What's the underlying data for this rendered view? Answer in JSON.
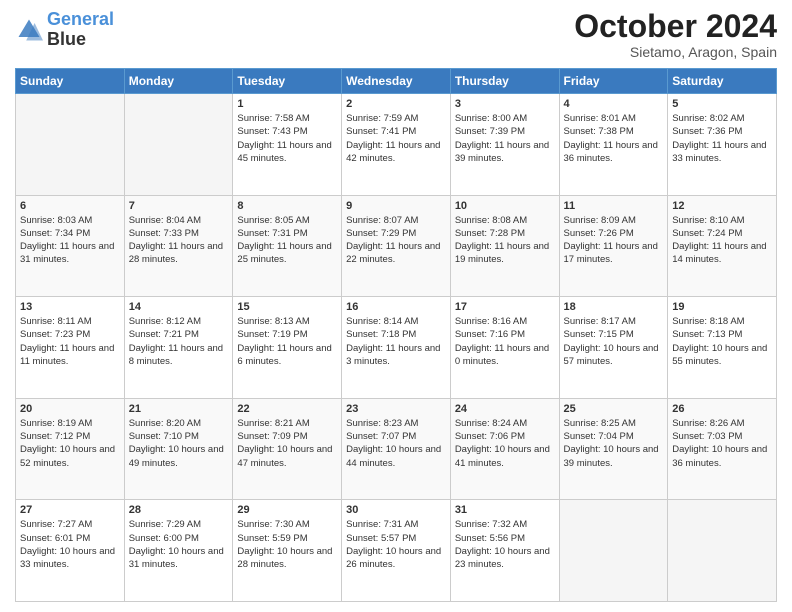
{
  "header": {
    "logo_line1": "General",
    "logo_line2": "Blue",
    "month": "October 2024",
    "location": "Sietamo, Aragon, Spain"
  },
  "weekdays": [
    "Sunday",
    "Monday",
    "Tuesday",
    "Wednesday",
    "Thursday",
    "Friday",
    "Saturday"
  ],
  "weeks": [
    [
      {
        "day": "",
        "info": ""
      },
      {
        "day": "",
        "info": ""
      },
      {
        "day": "1",
        "info": "Sunrise: 7:58 AM\nSunset: 7:43 PM\nDaylight: 11 hours and 45 minutes."
      },
      {
        "day": "2",
        "info": "Sunrise: 7:59 AM\nSunset: 7:41 PM\nDaylight: 11 hours and 42 minutes."
      },
      {
        "day": "3",
        "info": "Sunrise: 8:00 AM\nSunset: 7:39 PM\nDaylight: 11 hours and 39 minutes."
      },
      {
        "day": "4",
        "info": "Sunrise: 8:01 AM\nSunset: 7:38 PM\nDaylight: 11 hours and 36 minutes."
      },
      {
        "day": "5",
        "info": "Sunrise: 8:02 AM\nSunset: 7:36 PM\nDaylight: 11 hours and 33 minutes."
      }
    ],
    [
      {
        "day": "6",
        "info": "Sunrise: 8:03 AM\nSunset: 7:34 PM\nDaylight: 11 hours and 31 minutes."
      },
      {
        "day": "7",
        "info": "Sunrise: 8:04 AM\nSunset: 7:33 PM\nDaylight: 11 hours and 28 minutes."
      },
      {
        "day": "8",
        "info": "Sunrise: 8:05 AM\nSunset: 7:31 PM\nDaylight: 11 hours and 25 minutes."
      },
      {
        "day": "9",
        "info": "Sunrise: 8:07 AM\nSunset: 7:29 PM\nDaylight: 11 hours and 22 minutes."
      },
      {
        "day": "10",
        "info": "Sunrise: 8:08 AM\nSunset: 7:28 PM\nDaylight: 11 hours and 19 minutes."
      },
      {
        "day": "11",
        "info": "Sunrise: 8:09 AM\nSunset: 7:26 PM\nDaylight: 11 hours and 17 minutes."
      },
      {
        "day": "12",
        "info": "Sunrise: 8:10 AM\nSunset: 7:24 PM\nDaylight: 11 hours and 14 minutes."
      }
    ],
    [
      {
        "day": "13",
        "info": "Sunrise: 8:11 AM\nSunset: 7:23 PM\nDaylight: 11 hours and 11 minutes."
      },
      {
        "day": "14",
        "info": "Sunrise: 8:12 AM\nSunset: 7:21 PM\nDaylight: 11 hours and 8 minutes."
      },
      {
        "day": "15",
        "info": "Sunrise: 8:13 AM\nSunset: 7:19 PM\nDaylight: 11 hours and 6 minutes."
      },
      {
        "day": "16",
        "info": "Sunrise: 8:14 AM\nSunset: 7:18 PM\nDaylight: 11 hours and 3 minutes."
      },
      {
        "day": "17",
        "info": "Sunrise: 8:16 AM\nSunset: 7:16 PM\nDaylight: 11 hours and 0 minutes."
      },
      {
        "day": "18",
        "info": "Sunrise: 8:17 AM\nSunset: 7:15 PM\nDaylight: 10 hours and 57 minutes."
      },
      {
        "day": "19",
        "info": "Sunrise: 8:18 AM\nSunset: 7:13 PM\nDaylight: 10 hours and 55 minutes."
      }
    ],
    [
      {
        "day": "20",
        "info": "Sunrise: 8:19 AM\nSunset: 7:12 PM\nDaylight: 10 hours and 52 minutes."
      },
      {
        "day": "21",
        "info": "Sunrise: 8:20 AM\nSunset: 7:10 PM\nDaylight: 10 hours and 49 minutes."
      },
      {
        "day": "22",
        "info": "Sunrise: 8:21 AM\nSunset: 7:09 PM\nDaylight: 10 hours and 47 minutes."
      },
      {
        "day": "23",
        "info": "Sunrise: 8:23 AM\nSunset: 7:07 PM\nDaylight: 10 hours and 44 minutes."
      },
      {
        "day": "24",
        "info": "Sunrise: 8:24 AM\nSunset: 7:06 PM\nDaylight: 10 hours and 41 minutes."
      },
      {
        "day": "25",
        "info": "Sunrise: 8:25 AM\nSunset: 7:04 PM\nDaylight: 10 hours and 39 minutes."
      },
      {
        "day": "26",
        "info": "Sunrise: 8:26 AM\nSunset: 7:03 PM\nDaylight: 10 hours and 36 minutes."
      }
    ],
    [
      {
        "day": "27",
        "info": "Sunrise: 7:27 AM\nSunset: 6:01 PM\nDaylight: 10 hours and 33 minutes."
      },
      {
        "day": "28",
        "info": "Sunrise: 7:29 AM\nSunset: 6:00 PM\nDaylight: 10 hours and 31 minutes."
      },
      {
        "day": "29",
        "info": "Sunrise: 7:30 AM\nSunset: 5:59 PM\nDaylight: 10 hours and 28 minutes."
      },
      {
        "day": "30",
        "info": "Sunrise: 7:31 AM\nSunset: 5:57 PM\nDaylight: 10 hours and 26 minutes."
      },
      {
        "day": "31",
        "info": "Sunrise: 7:32 AM\nSunset: 5:56 PM\nDaylight: 10 hours and 23 minutes."
      },
      {
        "day": "",
        "info": ""
      },
      {
        "day": "",
        "info": ""
      }
    ]
  ]
}
